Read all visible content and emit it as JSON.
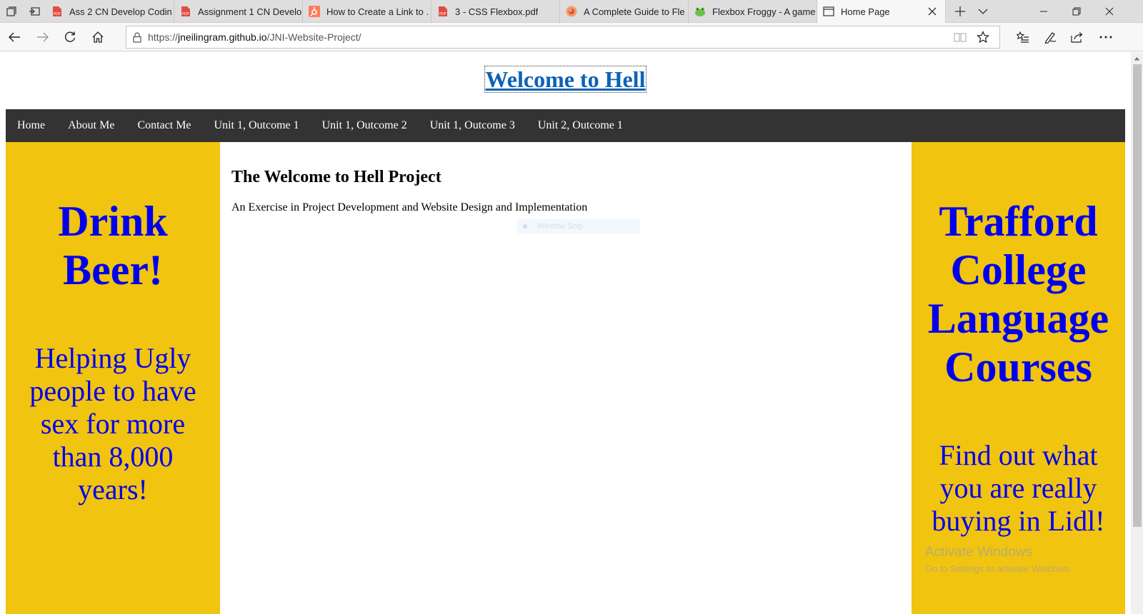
{
  "browser": {
    "tabs": [
      {
        "label": "Ass 2 CN Develop Codin",
        "icon": "pdf-icon",
        "active": false
      },
      {
        "label": "Assignment 1 CN Develo",
        "icon": "pdf-icon",
        "active": false
      },
      {
        "label": "How to Create a Link to .",
        "icon": "hubspot-icon",
        "active": false
      },
      {
        "label": "3 - CSS Flexbox.pdf",
        "icon": "pdf-icon",
        "active": false
      },
      {
        "label": "A Complete Guide to Fle",
        "icon": "css-tricks-icon",
        "active": false
      },
      {
        "label": "Flexbox Froggy - A game",
        "icon": "froggy-icon",
        "active": false
      },
      {
        "label": "Home Page",
        "icon": "page-icon",
        "active": true
      }
    ],
    "address": {
      "prefix": "https://",
      "host": "jneilingram.github.io",
      "path": "/JNI-Website-Project/"
    }
  },
  "page": {
    "title": "Welcome to Hell",
    "nav": [
      "Home",
      "About Me",
      "Contact Me",
      "Unit 1, Outcome 1",
      "Unit 1, Outcome 2",
      "Unit 1, Outcome 3",
      "Unit 2, Outcome 1"
    ],
    "left_ad": {
      "headline_lines": [
        "Drink",
        "Beer!"
      ],
      "sub_lines": [
        "Helping Ugly",
        "people to have",
        "sex for more",
        "than 8,000",
        "years!"
      ]
    },
    "main": {
      "heading": "The Welcome to Hell Project",
      "text": "An Exercise in Project Development and Website Design and Implementation"
    },
    "right_ad": {
      "headline_lines": [
        "Trafford",
        "College",
        "Language",
        "Courses"
      ],
      "sub_lines": [
        "Find out what",
        "you are really",
        "buying in Lidl!"
      ]
    }
  },
  "overlay": {
    "snip_label": "Window Snip",
    "activation_title": "Activate Windows",
    "activation_sub": "Go to Settings to activate Windows."
  },
  "colors": {
    "ad_background": "#f1c40f",
    "ad_text": "#0000ee",
    "nav_background": "#333333",
    "title_link": "#0b63b6"
  }
}
